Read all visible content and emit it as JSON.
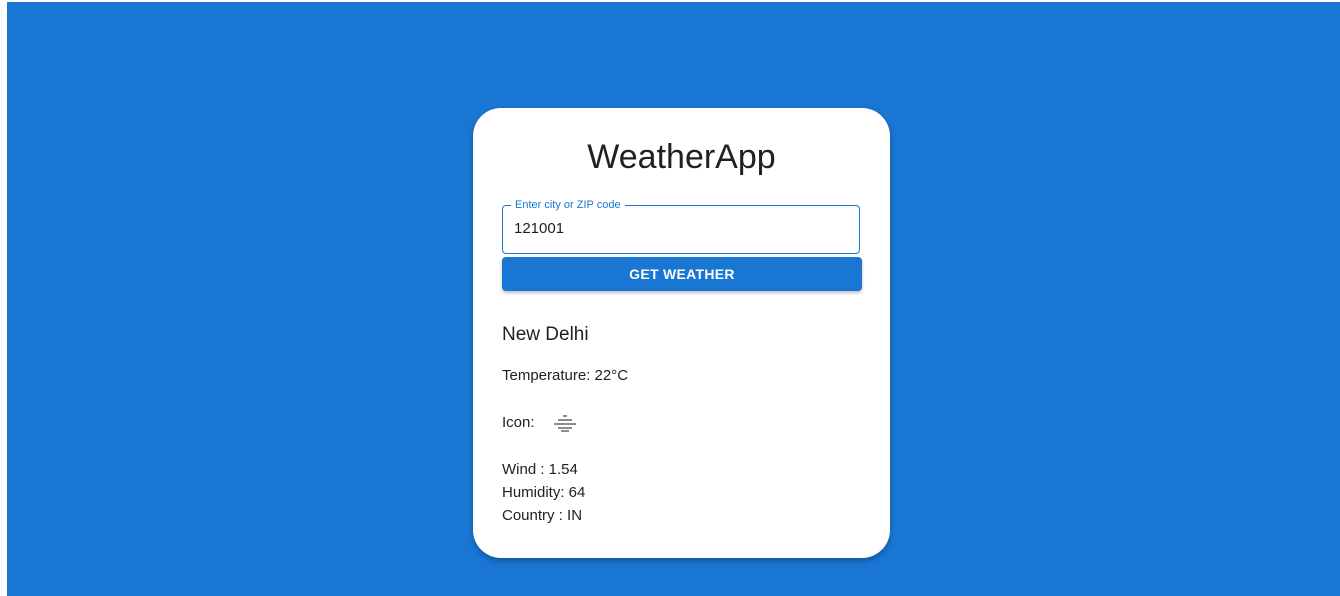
{
  "app": {
    "title": "WeatherApp"
  },
  "search": {
    "label": "Enter city or ZIP code",
    "value": "121001",
    "button_label": "GET WEATHER"
  },
  "weather": {
    "city": "New Delhi",
    "temperature_text": "Temperature: 22°C",
    "icon_label": "Icon:",
    "icon_name": "mist-icon",
    "wind_text": "Wind : 1.54",
    "humidity_text": "Humidity: 64",
    "country_text": "Country : IN"
  },
  "colors": {
    "background": "#1976d2",
    "accent": "#1976d2",
    "card": "#ffffff"
  }
}
